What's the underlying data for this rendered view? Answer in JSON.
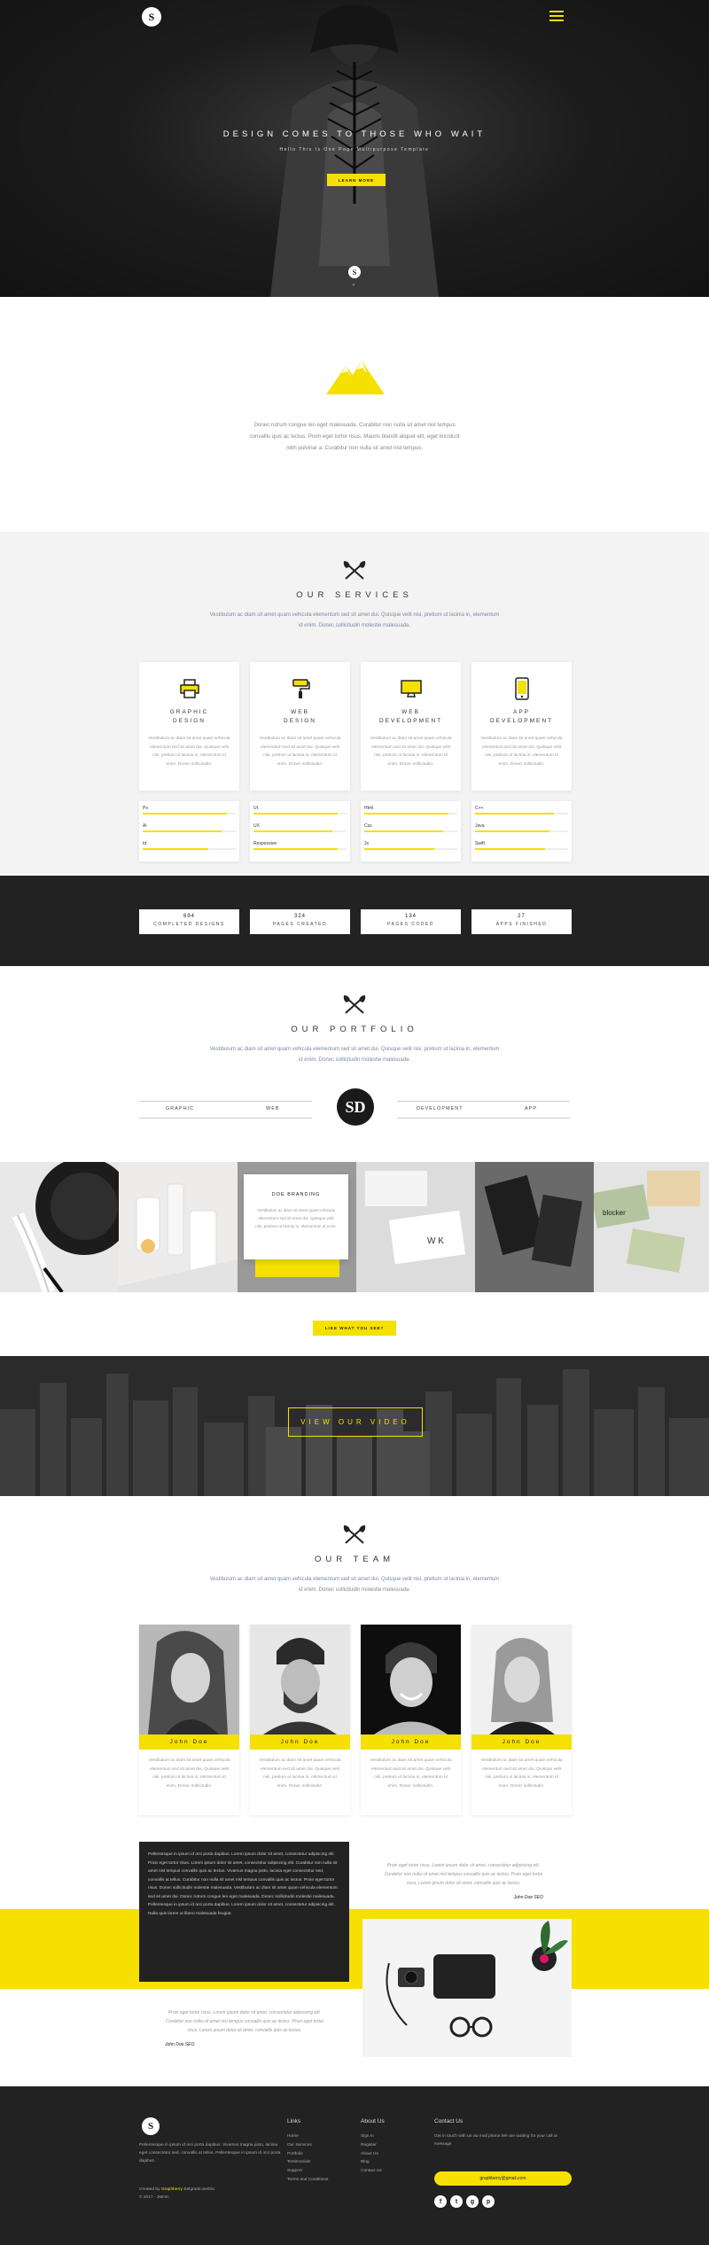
{
  "hero": {
    "logo": "S",
    "title": "DESIGN COMES TO THOSE WHO WAIT",
    "subtitle": "Hello This Is One Page Multipurpose Template",
    "button": "LEARN MORE",
    "badge": "S",
    "chevron": "⌄"
  },
  "intro": {
    "text": "Donec rutrum congue leo eget malesuada. Curabitur non nulla sit amet nisl tempus convallis quis ac lectus. Proin eget tortor risus. Mauris blandit aliquet elit, eget tincidunt nibh pulvinar a. Curabitur non nulla sit amet nisl tempus."
  },
  "services": {
    "title": "OUR SERVICES",
    "lead": "Vestibulum ac diam sit amet quam vehicula elementum sed sit amet dui. Quisque velit nisi, pretium ut lacinia in, elementum id enim. Donec sollicitudin molestie malesuada.",
    "cards": [
      {
        "icon": "printer-icon",
        "title1": "GRAPHIC",
        "title2": "DESIGN",
        "desc": "Vestibulum ac diam sit amet quam vehicula elementum sed sit amet dui. Quisque velit nisi, pretium ut lacinia in, elementum id enim. Donec sollicitudin."
      },
      {
        "icon": "paint-roller-icon",
        "title1": "WEB",
        "title2": "DESIGN",
        "desc": "Vestibulum ac diam sit amet quam vehicula elementum sed sit amet dui. Quisque velit nisi, pretium ut lacinia in, elementum id enim. Donec sollicitudin."
      },
      {
        "icon": "monitor-icon",
        "title1": "WEB",
        "title2": "DEVELOPMENT",
        "desc": "Vestibulum ac diam sit amet quam vehicula elementum sed sit amet dui. Quisque velit nisi, pretium ut lacinia in, elementum id enim. Donec sollicitudin."
      },
      {
        "icon": "smartphone-icon",
        "title1": "APP",
        "title2": "DEVELOPMENT",
        "desc": "Vestibulum ac diam sit amet quam vehicula elementum sed sit amet dui. Quisque velit nisi, pretium ut lacinia in, elementum id enim. Donec sollicitudin."
      }
    ],
    "skills": [
      [
        {
          "name": "Ps",
          "level": 0.9
        },
        {
          "name": "Ai",
          "level": 0.85
        },
        {
          "name": "Id",
          "level": 0.7
        }
      ],
      [
        {
          "name": "UI",
          "level": 0.9
        },
        {
          "name": "UX",
          "level": 0.85
        },
        {
          "name": "Responsive",
          "level": 0.9
        }
      ],
      [
        {
          "name": "Html",
          "level": 0.9
        },
        {
          "name": "Css",
          "level": 0.85
        },
        {
          "name": "Js",
          "level": 0.75
        }
      ],
      [
        {
          "name": "C++",
          "level": 0.85
        },
        {
          "name": "Java",
          "level": 0.8
        },
        {
          "name": "Swift",
          "level": 0.75
        }
      ]
    ]
  },
  "stats": [
    {
      "value": "694",
      "label": "COMPLETED DESIGNS"
    },
    {
      "value": "324",
      "label": "PAGES CREATED"
    },
    {
      "value": "134",
      "label": "PAGES CODED"
    },
    {
      "value": "27",
      "label": "APPS FINISHED"
    }
  ],
  "portfolio": {
    "title": "OUR PORTFOLIO",
    "lead": "Vestibulum ac diam sit amet quam vehicula elementum sed sit amet dui. Quisque velit nisi, pretium ut lacinia in, elementum id enim. Donec sollicitudin molestie malesuada.",
    "filters": [
      "GRAPHIC",
      "WEB",
      "DEVELOPMENT",
      "APP"
    ],
    "logo": "SD",
    "overlay_title": "DOE BRANDING",
    "overlay_desc": "Vestibulum ac diam sit amet quam vehicula elementum sed sit amet dui. Quisque velit nisi, pretium ut lacinia in, elementum id enim.",
    "button": "LIKE WHAT YOU SEE?"
  },
  "video": {
    "button": "VIEW OUR VIDEO"
  },
  "team": {
    "title": "OUR TEAM",
    "lead": "Vestibulum ac diam sit amet quam vehicula elementum sed sit amet dui. Quisque velit nisi, pretium ut lacinia in, elementum id enim. Donec sollicitudin molestie malesuada.",
    "members": [
      {
        "name": "John Doe",
        "desc": "Vestibulum ac diam sit amet quam vehicula elementum sed sit amet dui. Quisque velit nisi, pretium ut lacinia in, elementum id enim. Donec sollicitudin."
      },
      {
        "name": "John Doe",
        "desc": "Vestibulum ac diam sit amet quam vehicula elementum sed sit amet dui. Quisque velit nisi, pretium ut lacinia in, elementum id enim. Donec sollicitudin."
      },
      {
        "name": "John Doe",
        "desc": "Vestibulum ac diam sit amet quam vehicula elementum sed sit amet dui. Quisque velit nisi, pretium ut lacinia in, elementum id enim. Donec sollicitudin."
      },
      {
        "name": "John Doe",
        "desc": "Vestibulum ac diam sit amet quam vehicula elementum sed sit amet dui. Quisque velit nisi, pretium ut lacinia in, elementum id enim. Donec sollicitudin."
      }
    ]
  },
  "testimonials": {
    "box_text": "Pellentesque in ipsum id orci porta dapibus. Lorem ipsum dolor sit amet, consectetur adipiscing elit. Proin eget tortor risus. Lorem ipsum dolor sit amet, consectetur adipiscing elit. Curabitur non nulla sit amet nisl tempus convallis quis ac lectus. Vivamus magna justo, lacinia eget consectetur sed, convallis at tellus. Curabitur non nulla sit amet nisl tempus convallis quis ac lectus. Proin eget tortor risus. Donec sollicitudin molestie malesuada. Vestibulum ac diam sit amet quam vehicula elementum sed sit amet dui. Donec rutrum congue leo eget malesuada. Donec sollicitudin molestie malesuada. Pellentesque in ipsum id orci porta dapibus. Lorem ipsum dolor sit amet, consectetur adipiscing elit. Nulla quis lorem ut libero malesuada feugiat.",
    "quote1": "Proin eget tortor risus. Lorem ipsum dolor sit amet, consectetur adipiscing elit. Curabitur non nulla sit amet nisl tempus convallis quis ac lectus. Proin eget tortor risus. Lorem ipsum dolor sit amet, convallis quis ac lectus.",
    "author1": "John Doe SEO",
    "quote2": "Proin eget tortor risus. Lorem ipsum dolor sit amet, consectetur adipiscing elit. Curabitur non nulla sit amet nisl tempus convallis quis ac lectus. Proin eget tortor risus. Lorem ipsum dolor sit amet, convallis quis ac lectus.",
    "author2": "John Doe SEO"
  },
  "footer": {
    "logo": "S",
    "about": "Pellentesque in ipsum id orci porta dapibus. Vivamus magna justo, lacinia eget consectetur sed, convallis at tellus. Pellentesque in ipsum id orci porta dapibus.",
    "credit_prefix": "Created by",
    "credit_brand": "Graphberry",
    "credit_suffix": "Belgrade,Serbia",
    "copyright": "© 2017 - JMHrc",
    "links": {
      "title": "Links",
      "items": [
        "Home",
        "Our Services",
        "Portfolio",
        "Testimonials",
        "Support",
        "Terms and Conditions"
      ]
    },
    "about_us": {
      "title": "About Us",
      "items": [
        "Sign In",
        "Register",
        "About Us",
        "Blog",
        "Contact Us"
      ]
    },
    "contact": {
      "title": "Contact Us",
      "text": "Get in touch with us via mail phone.We are waiting for your call or message",
      "email": "graphberry@gmail.com"
    },
    "social": [
      "f",
      "t",
      "g",
      "p"
    ]
  },
  "colors": {
    "accent": "#f5e000",
    "dark": "#222222",
    "light": "#f3f3f3"
  }
}
